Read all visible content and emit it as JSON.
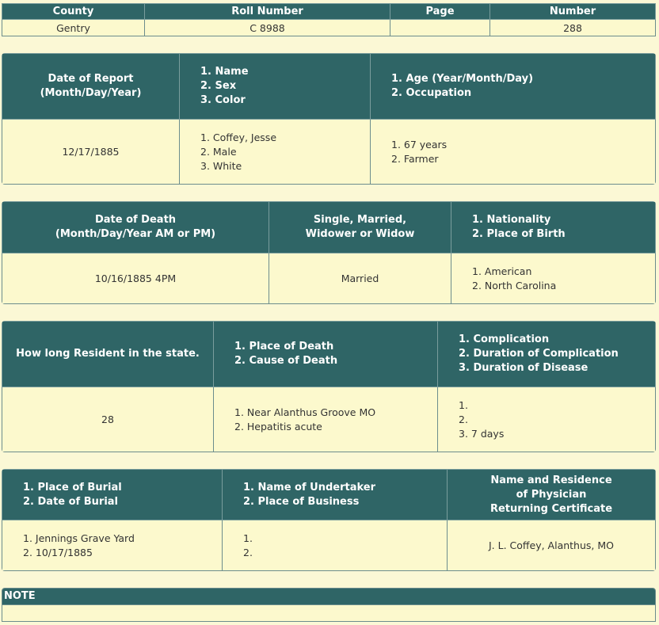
{
  "header_table": {
    "columns": [
      "County",
      "Roll Number",
      "Page",
      "Number"
    ],
    "values": [
      "Gentry",
      "C 8988",
      "",
      "288"
    ]
  },
  "section1": {
    "headers": [
      [
        "Date of Report",
        "(Month/Day/Year)"
      ],
      [
        "1. Name",
        "2. Sex",
        "3. Color"
      ],
      [
        "1. Age (Year/Month/Day)",
        "2. Occupation"
      ]
    ],
    "values": [
      [
        "12/17/1885"
      ],
      [
        "1. Coffey, Jesse",
        "2. Male",
        "3. White"
      ],
      [
        "1. 67 years",
        "2. Farmer"
      ]
    ]
  },
  "section2": {
    "headers": [
      [
        "Date of Death",
        "(Month/Day/Year AM or PM)"
      ],
      [
        "Single, Married,",
        "Widower or Widow"
      ],
      [
        "1. Nationality",
        "2. Place of Birth"
      ]
    ],
    "values": [
      [
        "10/16/1885 4PM"
      ],
      [
        "Married"
      ],
      [
        "1. American",
        "2. North Carolina"
      ]
    ]
  },
  "section3": {
    "headers": [
      [
        "How long Resident in the state."
      ],
      [
        "1. Place of Death",
        "2. Cause of Death"
      ],
      [
        "1. Complication",
        "2. Duration of Complication",
        "3. Duration of Disease"
      ]
    ],
    "values": [
      [
        "28"
      ],
      [
        "1. Near Alanthus Groove MO",
        "2. Hepatitis acute"
      ],
      [
        "1.",
        "2.",
        "3. 7 days"
      ]
    ]
  },
  "section4": {
    "headers": [
      [
        "1. Place of Burial",
        "2. Date of Burial"
      ],
      [
        "1. Name of Undertaker",
        "2. Place of Business"
      ],
      [
        "Name and Residence",
        "of Physician",
        "Returning Certificate"
      ]
    ],
    "values": [
      [
        "1. Jennings Grave Yard",
        "2. 10/17/1885"
      ],
      [
        "1.",
        "2."
      ],
      [
        "J. L. Coffey, Alanthus, MO"
      ]
    ]
  },
  "note": {
    "label": "NOTE",
    "text": ""
  },
  "colors": {
    "header_bg": "#2f6566",
    "cell_bg": "#fcf9cd",
    "page_bg": "#fbf8d5"
  }
}
